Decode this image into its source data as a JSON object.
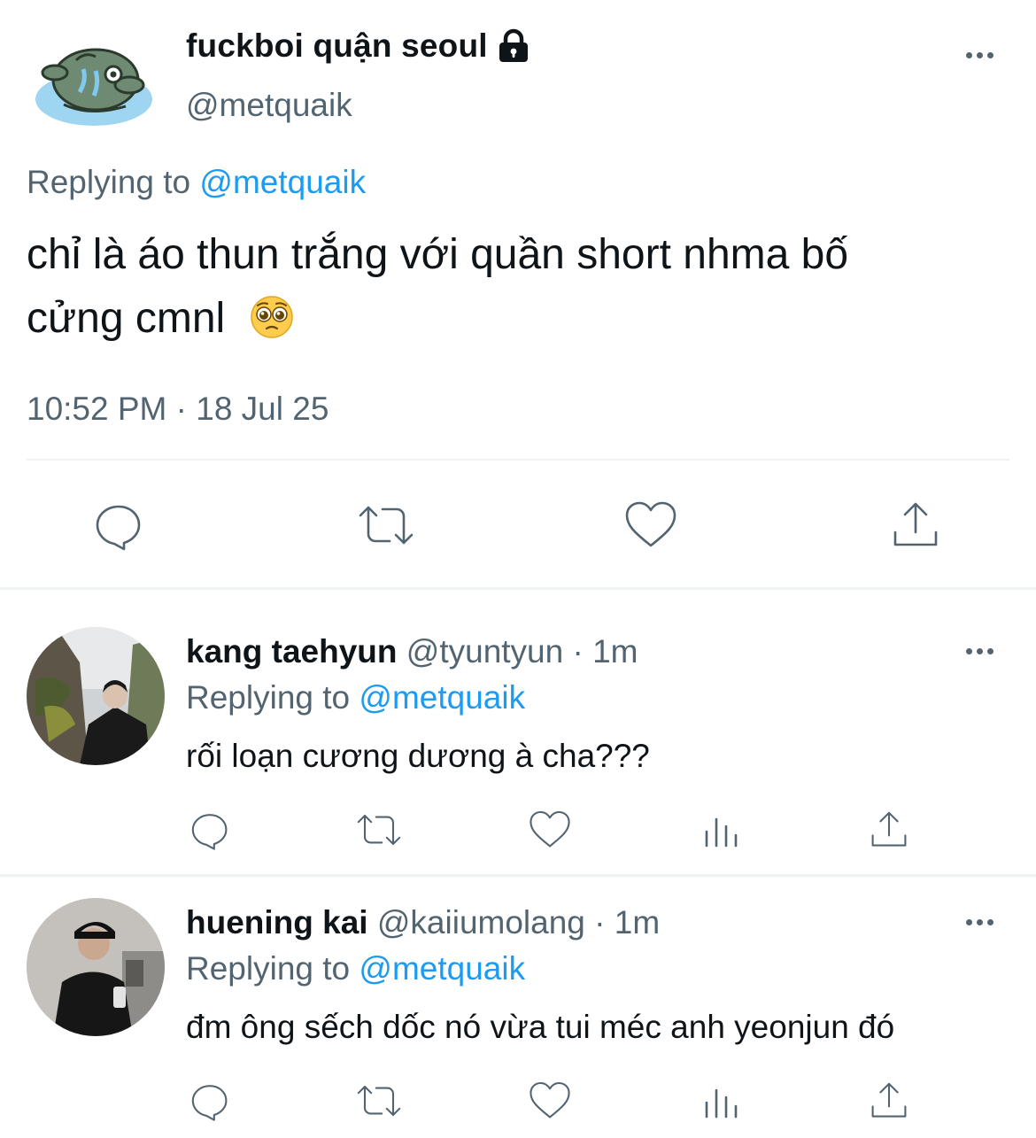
{
  "main_tweet": {
    "display_name": "fuckboi quận seoul",
    "handle": "@metquaik",
    "replying_label": "Replying to",
    "replying_handle": "@metquaik",
    "text_line1": "chỉ là áo thun trắng với quần short nhma bố",
    "text_line2": "cửng cmnl",
    "emoji": "🥺",
    "timestamp": "10:52 PM · 18 Jul 25",
    "locked_icon": "lock-icon"
  },
  "actions": {
    "reply_icon": "reply-icon",
    "retweet_icon": "retweet-icon",
    "like_icon": "heart-icon",
    "views_icon": "views-icon",
    "share_icon": "share-icon"
  },
  "replies": [
    {
      "display_name": "kang taehyun",
      "handle": "@tyuntyun",
      "time": "· 1m",
      "replying_label": "Replying to",
      "replying_handle": "@metquaik",
      "text": "rối loạn cương dương à cha???"
    },
    {
      "display_name": "huening kai",
      "handle": "@kaiiumolang",
      "time": "· 1m",
      "replying_label": "Replying to",
      "replying_handle": "@metquaik",
      "text": "đm ông sếch dốc nó vừa tui méc anh yeonjun đó"
    }
  ],
  "colors": {
    "accent": "#1d9bf0",
    "secondary_text": "#536471",
    "primary_text": "#0f1419",
    "divider": "#eff3f4"
  }
}
